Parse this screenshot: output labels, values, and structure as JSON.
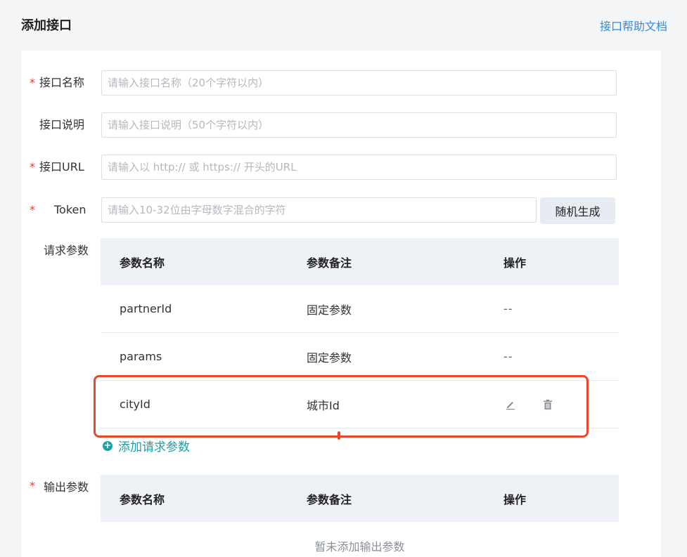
{
  "header": {
    "title": "添加接口",
    "help_link": "接口帮助文档"
  },
  "form": {
    "name": {
      "required_mark": "*",
      "label": "接口名称",
      "placeholder": "请输入接口名称（20个字符以内）",
      "value": ""
    },
    "desc": {
      "label": "接口说明",
      "placeholder": "请输入接口说明（50个字符以内）",
      "value": ""
    },
    "url": {
      "required_mark": "*",
      "label": "接口URL",
      "placeholder": "请输入以 http:// 或 https:// 开头的URL",
      "value": ""
    },
    "token": {
      "required_mark": "*",
      "label": "Token",
      "placeholder": "请输入10-32位由字母数字混合的字符",
      "value": "",
      "generate_button": "随机生成"
    }
  },
  "request_params": {
    "label": "请求参数",
    "columns": [
      "参数名称",
      "参数备注",
      "操作"
    ],
    "rows": [
      {
        "name": "partnerId",
        "note": "固定参数",
        "op": "--"
      },
      {
        "name": "params",
        "note": "固定参数",
        "op": "--"
      },
      {
        "name": "cityId",
        "note": "城市Id",
        "op_icons": [
          "edit-icon",
          "trash-icon"
        ]
      }
    ],
    "add_label": "添加请求参数"
  },
  "output_params": {
    "required_mark": "*",
    "label": "输出参数",
    "columns": [
      "参数名称",
      "参数备注",
      "操作"
    ],
    "empty_text": "暂未添加输出参数"
  },
  "colors": {
    "accent_link": "#2f8de4",
    "accent_teal": "#17a2a7",
    "required": "#e53935",
    "highlight": "#e8482b",
    "table_header_bg": "#eef1f6"
  }
}
